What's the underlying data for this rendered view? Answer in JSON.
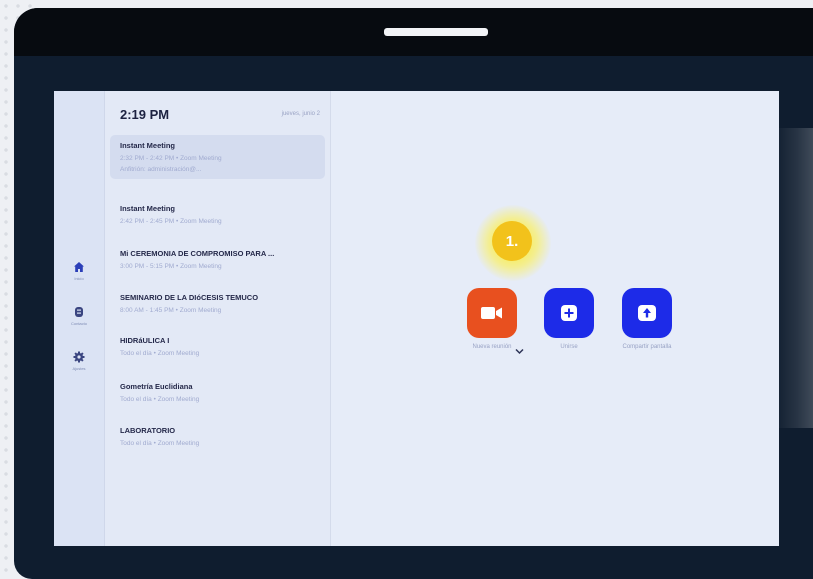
{
  "device": {
    "screen": {
      "rail": {
        "items": [
          {
            "label": "Inicio",
            "icon": "home-icon"
          },
          {
            "label": "Contacto",
            "icon": "contacts-icon"
          },
          {
            "label": "Ajustes",
            "icon": "gear-icon"
          }
        ]
      },
      "header": {
        "time": "2:19 PM",
        "date": "jueves, junio 2"
      },
      "meetings": [
        {
          "title": "Instant Meeting",
          "subtitle": "2:32 PM - 2:42 PM • Zoom Meeting",
          "extra": "Anfitrión: administración@..."
        },
        {
          "title": "Instant Meeting",
          "subtitle": "2:42 PM - 2:45 PM • Zoom Meeting"
        },
        {
          "title": "Mi CEREMONIA DE COMPROMISO PARA ...",
          "subtitle": "3:00 PM - 5:15 PM • Zoom Meeting"
        },
        {
          "title": "SEMINARIO DE LA DIóCESIS TEMUCO",
          "subtitle": "8:00 AM - 1:45 PM • Zoom Meeting"
        },
        {
          "title": "HIDRáULICA I",
          "subtitle": "Todo el día • Zoom Meeting"
        },
        {
          "title": "Gometría Euclidiana",
          "subtitle": "Todo el día • Zoom Meeting"
        },
        {
          "title": "LABORATORIO",
          "subtitle": "Todo el día • Zoom Meeting"
        }
      ],
      "actions": {
        "new_meeting": {
          "label": "Nueva reunión",
          "icon": "video-camera-icon",
          "color": "#e8501f"
        },
        "join": {
          "label": "Unirse",
          "icon": "plus-icon",
          "color": "#1d2be8"
        },
        "share": {
          "label": "Compartir pantalla",
          "icon": "upload-arrow-icon",
          "color": "#1d2be8"
        }
      },
      "annotation": {
        "label": "1."
      }
    }
  }
}
